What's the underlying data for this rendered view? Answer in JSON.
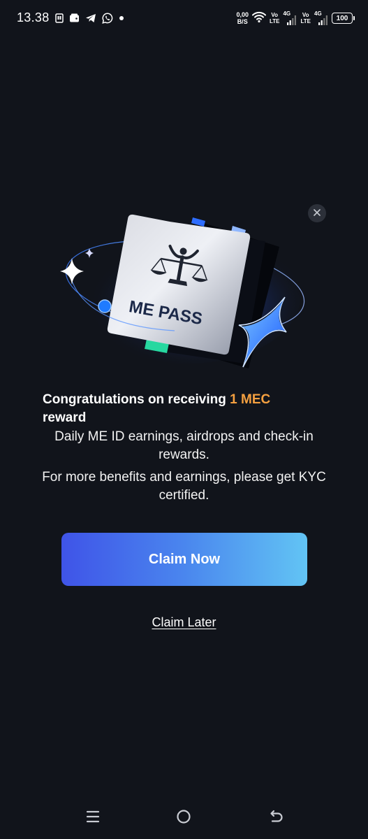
{
  "status_bar": {
    "time": "13.38",
    "net_speed_value": "0,00",
    "net_speed_unit": "B/S",
    "sim1_volte_top": "Vo",
    "sim1_volte_bottom": "LTE",
    "sim1_network": "4G",
    "sim2_volte_top": "Vo",
    "sim2_volte_bottom": "LTE",
    "sim2_network": "4G",
    "battery_level": "100",
    "left_icons": [
      "sim-card-icon",
      "wallet-icon",
      "telegram-icon",
      "whatsapp-icon",
      "notification-dot-icon"
    ]
  },
  "modal": {
    "close_icon": "close-icon",
    "hero": {
      "card_text": "ME PASS",
      "card_emblem": "justice-scale-person-icon",
      "decorations": [
        "sparkle-icon",
        "four-point-star-icon",
        "orbit-ring"
      ]
    },
    "title_prefix": "Congratulations on receiving",
    "title_highlight": "1 MEC",
    "title_suffix": "reward",
    "description_1": "Daily ME ID earnings, airdrops and check-in rewards.",
    "description_2": "For more benefits and earnings, please get KYC certified.",
    "primary_button": "Claim Now",
    "secondary_link": "Claim Later"
  },
  "nav_bar": {
    "icons": [
      "menu-icon",
      "home-icon",
      "back-icon"
    ]
  },
  "colors": {
    "background": "#11141b",
    "accent_orange": "#f5a040",
    "button_gradient_start": "#3f54e8",
    "button_gradient_end": "#62c4f4"
  }
}
